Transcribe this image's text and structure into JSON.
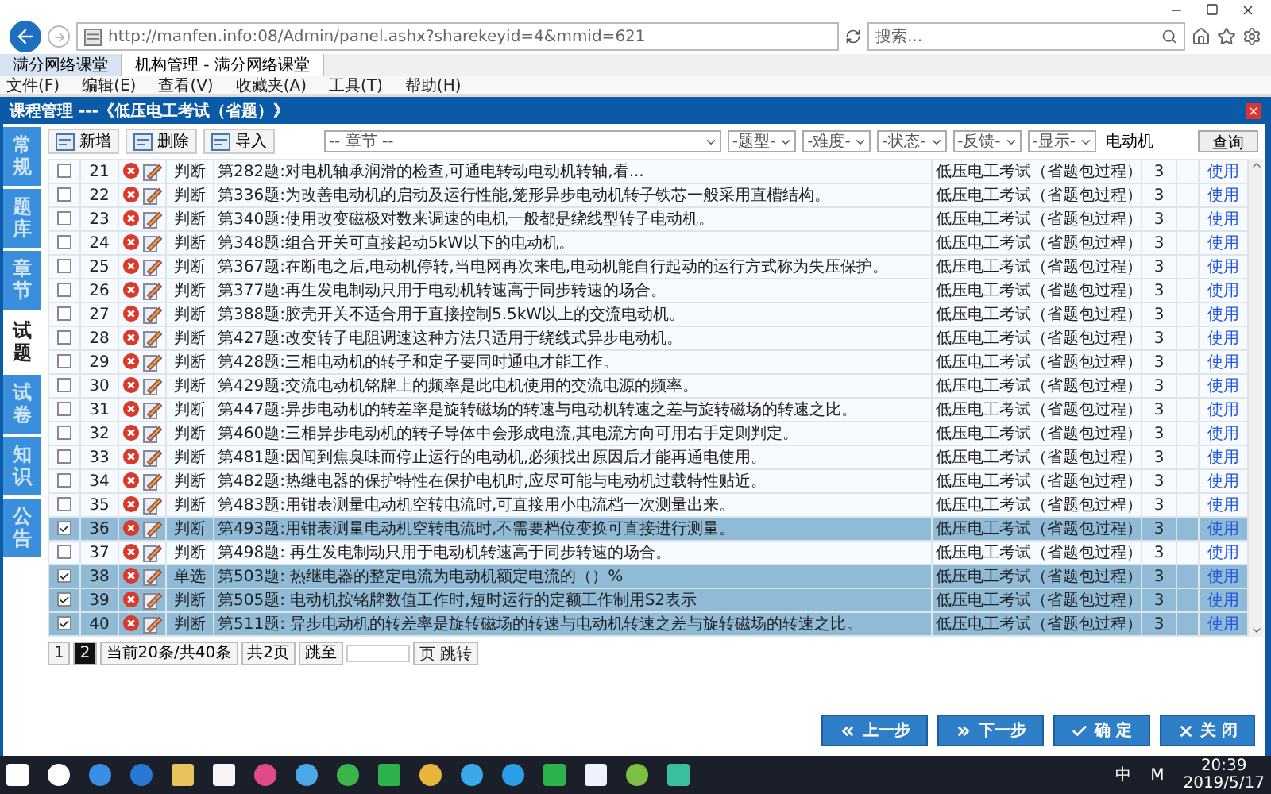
{
  "browser": {
    "address": "http://manfen.info:08/Admin/panel.ashx?sharekeyid=4&mmid=621",
    "search": {
      "placeholder": "搜索..."
    },
    "tabs": [
      {
        "label": "满分网络课堂",
        "selected": false
      },
      {
        "label": "机构管理 - 满分网络课堂",
        "selected": true
      }
    ],
    "menu": [
      "文件(F)",
      "编辑(E)",
      "查看(V)",
      "收藏夹(A)",
      "工具(T)",
      "帮助(H)"
    ]
  },
  "panel": {
    "title": "课程管理 ---《低压电工考试（省题）》"
  },
  "sidebar": {
    "items": [
      {
        "label": "常规",
        "selected": false
      },
      {
        "label": "题库",
        "selected": false
      },
      {
        "label": "章节",
        "selected": false
      },
      {
        "label": "试题",
        "selected": true
      },
      {
        "label": "试卷",
        "selected": false
      },
      {
        "label": "知识",
        "selected": false
      },
      {
        "label": "公告",
        "selected": false
      }
    ]
  },
  "toolbar": {
    "buttons": [
      "新增",
      "删除",
      "导入"
    ],
    "filters": [
      "-- 章节 --",
      "-题型-",
      "-难度-",
      "-状态-",
      "-反馈-",
      "-显示-"
    ],
    "search": {
      "value": "电动机"
    },
    "query_button": "查询"
  },
  "table": {
    "rows": [
      {
        "number": "21",
        "checked": false,
        "type": "判断",
        "question": "第282题:对电机轴承润滑的检查,可通电转动电动机转轴,看...",
        "course": "低压电工考试（省题包过程）",
        "score": "3",
        "action": "使用"
      },
      {
        "number": "22",
        "checked": false,
        "type": "判断",
        "question": "第336题:为改善电动机的启动及运行性能,笼形异步电动机转子铁芯一般采用直槽结构。",
        "course": "低压电工考试（省题包过程）",
        "score": "3",
        "action": "使用"
      },
      {
        "number": "23",
        "checked": false,
        "type": "判断",
        "question": "第340题:使用改变磁极对数来调速的电机一般都是绕线型转子电动机。",
        "course": "低压电工考试（省题包过程）",
        "score": "3",
        "action": "使用"
      },
      {
        "number": "24",
        "checked": false,
        "type": "判断",
        "question": "第348题:组合开关可直接起动5kW以下的电动机。",
        "course": "低压电工考试（省题包过程）",
        "score": "3",
        "action": "使用"
      },
      {
        "number": "25",
        "checked": false,
        "type": "判断",
        "question": "第367题:在断电之后,电动机停转,当电网再次来电,电动机能自行起动的运行方式称为失压保护。",
        "course": "低压电工考试（省题包过程）",
        "score": "3",
        "action": "使用"
      },
      {
        "number": "26",
        "checked": false,
        "type": "判断",
        "question": "第377题:再生发电制动只用于电动机转速高于同步转速的场合。",
        "course": "低压电工考试（省题包过程）",
        "score": "3",
        "action": "使用"
      },
      {
        "number": "27",
        "checked": false,
        "type": "判断",
        "question": "第388题:胶壳开关不适合用于直接控制5.5kW以上的交流电动机。",
        "course": "低压电工考试（省题包过程）",
        "score": "3",
        "action": "使用"
      },
      {
        "number": "28",
        "checked": false,
        "type": "判断",
        "question": "第427题:改变转子电阻调速这种方法只适用于绕线式异步电动机。",
        "course": "低压电工考试（省题包过程）",
        "score": "3",
        "action": "使用"
      },
      {
        "number": "29",
        "checked": false,
        "type": "判断",
        "question": "第428题:三相电动机的转子和定子要同时通电才能工作。",
        "course": "低压电工考试（省题包过程）",
        "score": "3",
        "action": "使用"
      },
      {
        "number": "30",
        "checked": false,
        "type": "判断",
        "question": "第429题:交流电动机铭牌上的频率是此电机使用的交流电源的频率。",
        "course": "低压电工考试（省题包过程）",
        "score": "3",
        "action": "使用"
      },
      {
        "number": "31",
        "checked": false,
        "type": "判断",
        "question": "第447题:异步电动机的转差率是旋转磁场的转速与电动机转速之差与旋转磁场的转速之比。",
        "course": "低压电工考试（省题包过程）",
        "score": "3",
        "action": "使用"
      },
      {
        "number": "32",
        "checked": false,
        "type": "判断",
        "question": "第460题:三相异步电动机的转子导体中会形成电流,其电流方向可用右手定则判定。",
        "course": "低压电工考试（省题包过程）",
        "score": "3",
        "action": "使用"
      },
      {
        "number": "33",
        "checked": false,
        "type": "判断",
        "question": "第481题:因闻到焦臭味而停止运行的电动机,必须找出原因后才能再通电使用。",
        "course": "低压电工考试（省题包过程）",
        "score": "3",
        "action": "使用"
      },
      {
        "number": "34",
        "checked": false,
        "type": "判断",
        "question": "第482题:热继电器的保护特性在保护电机时,应尽可能与电动机过载特性贴近。",
        "course": "低压电工考试（省题包过程）",
        "score": "3",
        "action": "使用"
      },
      {
        "number": "35",
        "checked": false,
        "type": "判断",
        "question": "第483题:用钳表测量电动机空转电流时,可直接用小电流档一次测量出来。",
        "course": "低压电工考试（省题包过程）",
        "score": "3",
        "action": "使用"
      },
      {
        "number": "36",
        "checked": true,
        "type": "判断",
        "question": "第493题:用钳表测量电动机空转电流时,不需要档位变换可直接进行测量。",
        "course": "低压电工考试（省题包过程）",
        "score": "3",
        "action": "使用"
      },
      {
        "number": "37",
        "checked": false,
        "type": "判断",
        "question": "第498题: 再生发电制动只用于电动机转速高于同步转速的场合。",
        "course": "低压电工考试（省题包过程）",
        "score": "3",
        "action": "使用"
      },
      {
        "number": "38",
        "checked": true,
        "type": "单选",
        "question": "第503题: 热继电器的整定电流为电动机额定电流的（）%",
        "course": "低压电工考试（省题包过程）",
        "score": "3",
        "action": "使用"
      },
      {
        "number": "39",
        "checked": true,
        "type": "判断",
        "question": "第505题: 电动机按铭牌数值工作时,短时运行的定额工作制用S2表示",
        "course": "低压电工考试（省题包过程）",
        "score": "3",
        "action": "使用"
      },
      {
        "number": "40",
        "checked": true,
        "type": "判断",
        "question": "第511题: 异步电动机的转差率是旋转磁场的转速与电动机转速之差与旋转磁场的转速之比。",
        "course": "低压电工考试（省题包过程）",
        "score": "3",
        "action": "使用"
      }
    ]
  },
  "pagination": {
    "pages": [
      {
        "label": "1",
        "selected": false
      },
      {
        "label": "2",
        "selected": true
      }
    ],
    "summary": "当前20条/共40条",
    "total_pages": "共2页",
    "jump_label": "跳至",
    "jump_button": "页 跳转"
  },
  "buttons": [
    {
      "kind": "prev",
      "label": "上一步"
    },
    {
      "kind": "next",
      "label": "下一步"
    },
    {
      "kind": "confirm",
      "label": "确 定"
    },
    {
      "kind": "close",
      "label": "关 闭"
    }
  ],
  "taskbar": {
    "ime": "中",
    "ime_mode": "M",
    "time": "20:39",
    "date": "2019/5/17"
  }
}
